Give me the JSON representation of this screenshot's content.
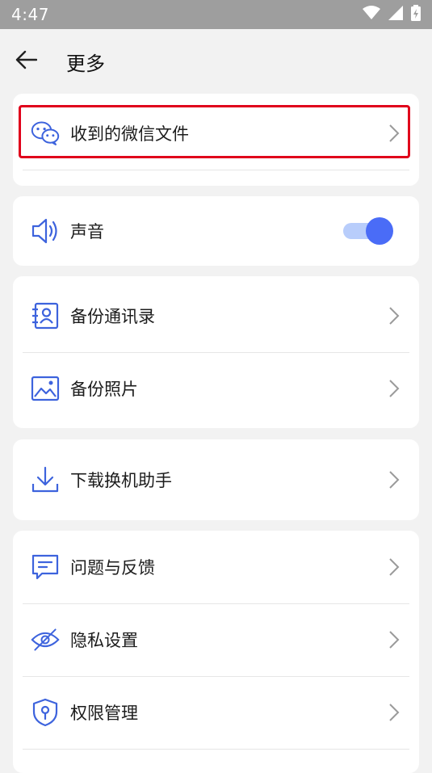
{
  "status_bar": {
    "time": "4:47"
  },
  "header": {
    "title": "更多"
  },
  "sections": {
    "wechat": {
      "label": "收到的微信文件"
    },
    "sound": {
      "label": "声音",
      "toggle_on": true
    },
    "backup_contacts": {
      "label": "备份通讯录"
    },
    "backup_photos": {
      "label": "备份照片"
    },
    "download_helper": {
      "label": "下载换机助手"
    },
    "feedback": {
      "label": "问题与反馈"
    },
    "privacy": {
      "label": "隐私设置"
    },
    "permissions": {
      "label": "权限管理"
    }
  },
  "colors": {
    "accent": "#4a6cf7",
    "highlight": "#e0001b",
    "icon": "#3d63dd"
  }
}
